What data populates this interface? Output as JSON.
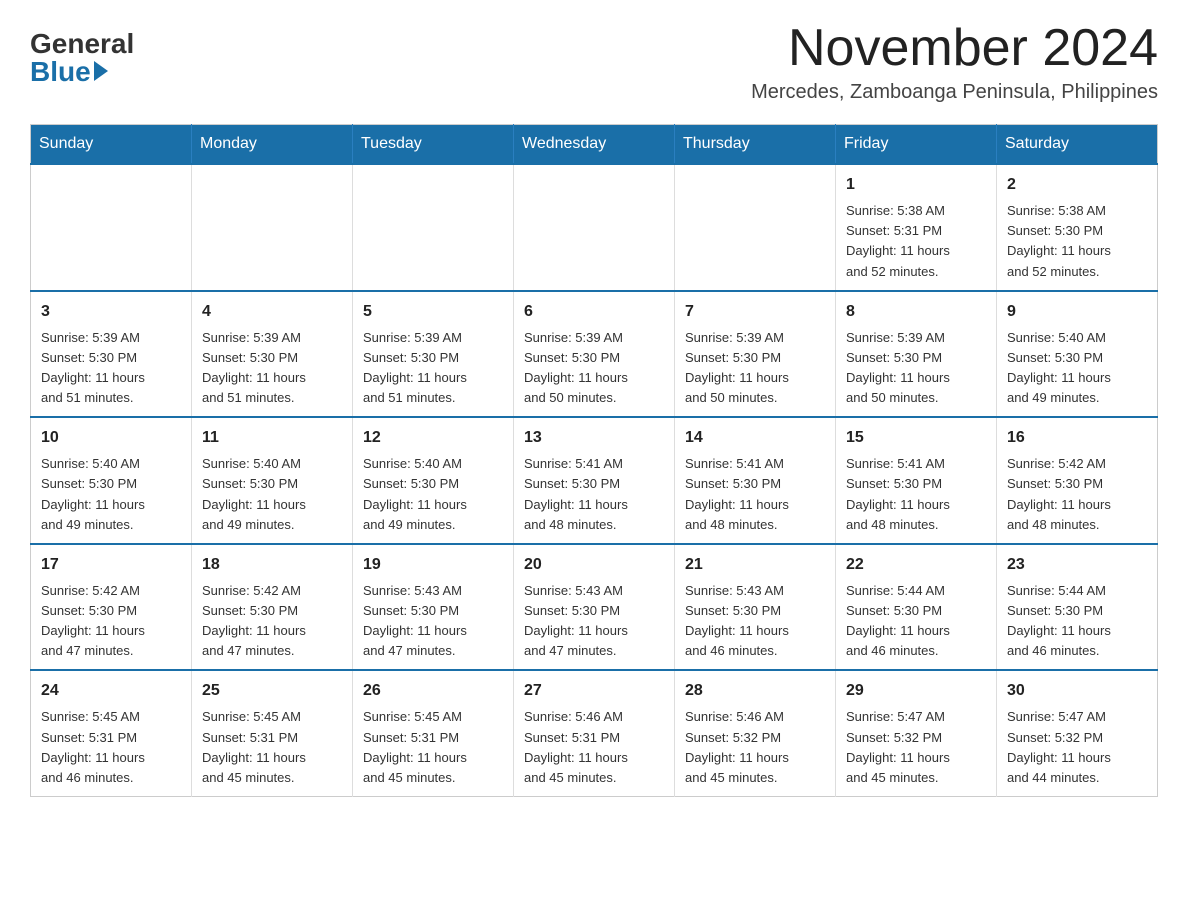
{
  "logo": {
    "general": "General",
    "blue": "Blue"
  },
  "title": "November 2024",
  "location": "Mercedes, Zamboanga Peninsula, Philippines",
  "days_of_week": [
    "Sunday",
    "Monday",
    "Tuesday",
    "Wednesday",
    "Thursday",
    "Friday",
    "Saturday"
  ],
  "weeks": [
    [
      {
        "day": "",
        "info": ""
      },
      {
        "day": "",
        "info": ""
      },
      {
        "day": "",
        "info": ""
      },
      {
        "day": "",
        "info": ""
      },
      {
        "day": "",
        "info": ""
      },
      {
        "day": "1",
        "info": "Sunrise: 5:38 AM\nSunset: 5:31 PM\nDaylight: 11 hours\nand 52 minutes."
      },
      {
        "day": "2",
        "info": "Sunrise: 5:38 AM\nSunset: 5:30 PM\nDaylight: 11 hours\nand 52 minutes."
      }
    ],
    [
      {
        "day": "3",
        "info": "Sunrise: 5:39 AM\nSunset: 5:30 PM\nDaylight: 11 hours\nand 51 minutes."
      },
      {
        "day": "4",
        "info": "Sunrise: 5:39 AM\nSunset: 5:30 PM\nDaylight: 11 hours\nand 51 minutes."
      },
      {
        "day": "5",
        "info": "Sunrise: 5:39 AM\nSunset: 5:30 PM\nDaylight: 11 hours\nand 51 minutes."
      },
      {
        "day": "6",
        "info": "Sunrise: 5:39 AM\nSunset: 5:30 PM\nDaylight: 11 hours\nand 50 minutes."
      },
      {
        "day": "7",
        "info": "Sunrise: 5:39 AM\nSunset: 5:30 PM\nDaylight: 11 hours\nand 50 minutes."
      },
      {
        "day": "8",
        "info": "Sunrise: 5:39 AM\nSunset: 5:30 PM\nDaylight: 11 hours\nand 50 minutes."
      },
      {
        "day": "9",
        "info": "Sunrise: 5:40 AM\nSunset: 5:30 PM\nDaylight: 11 hours\nand 49 minutes."
      }
    ],
    [
      {
        "day": "10",
        "info": "Sunrise: 5:40 AM\nSunset: 5:30 PM\nDaylight: 11 hours\nand 49 minutes."
      },
      {
        "day": "11",
        "info": "Sunrise: 5:40 AM\nSunset: 5:30 PM\nDaylight: 11 hours\nand 49 minutes."
      },
      {
        "day": "12",
        "info": "Sunrise: 5:40 AM\nSunset: 5:30 PM\nDaylight: 11 hours\nand 49 minutes."
      },
      {
        "day": "13",
        "info": "Sunrise: 5:41 AM\nSunset: 5:30 PM\nDaylight: 11 hours\nand 48 minutes."
      },
      {
        "day": "14",
        "info": "Sunrise: 5:41 AM\nSunset: 5:30 PM\nDaylight: 11 hours\nand 48 minutes."
      },
      {
        "day": "15",
        "info": "Sunrise: 5:41 AM\nSunset: 5:30 PM\nDaylight: 11 hours\nand 48 minutes."
      },
      {
        "day": "16",
        "info": "Sunrise: 5:42 AM\nSunset: 5:30 PM\nDaylight: 11 hours\nand 48 minutes."
      }
    ],
    [
      {
        "day": "17",
        "info": "Sunrise: 5:42 AM\nSunset: 5:30 PM\nDaylight: 11 hours\nand 47 minutes."
      },
      {
        "day": "18",
        "info": "Sunrise: 5:42 AM\nSunset: 5:30 PM\nDaylight: 11 hours\nand 47 minutes."
      },
      {
        "day": "19",
        "info": "Sunrise: 5:43 AM\nSunset: 5:30 PM\nDaylight: 11 hours\nand 47 minutes."
      },
      {
        "day": "20",
        "info": "Sunrise: 5:43 AM\nSunset: 5:30 PM\nDaylight: 11 hours\nand 47 minutes."
      },
      {
        "day": "21",
        "info": "Sunrise: 5:43 AM\nSunset: 5:30 PM\nDaylight: 11 hours\nand 46 minutes."
      },
      {
        "day": "22",
        "info": "Sunrise: 5:44 AM\nSunset: 5:30 PM\nDaylight: 11 hours\nand 46 minutes."
      },
      {
        "day": "23",
        "info": "Sunrise: 5:44 AM\nSunset: 5:30 PM\nDaylight: 11 hours\nand 46 minutes."
      }
    ],
    [
      {
        "day": "24",
        "info": "Sunrise: 5:45 AM\nSunset: 5:31 PM\nDaylight: 11 hours\nand 46 minutes."
      },
      {
        "day": "25",
        "info": "Sunrise: 5:45 AM\nSunset: 5:31 PM\nDaylight: 11 hours\nand 45 minutes."
      },
      {
        "day": "26",
        "info": "Sunrise: 5:45 AM\nSunset: 5:31 PM\nDaylight: 11 hours\nand 45 minutes."
      },
      {
        "day": "27",
        "info": "Sunrise: 5:46 AM\nSunset: 5:31 PM\nDaylight: 11 hours\nand 45 minutes."
      },
      {
        "day": "28",
        "info": "Sunrise: 5:46 AM\nSunset: 5:32 PM\nDaylight: 11 hours\nand 45 minutes."
      },
      {
        "day": "29",
        "info": "Sunrise: 5:47 AM\nSunset: 5:32 PM\nDaylight: 11 hours\nand 45 minutes."
      },
      {
        "day": "30",
        "info": "Sunrise: 5:47 AM\nSunset: 5:32 PM\nDaylight: 11 hours\nand 44 minutes."
      }
    ]
  ]
}
